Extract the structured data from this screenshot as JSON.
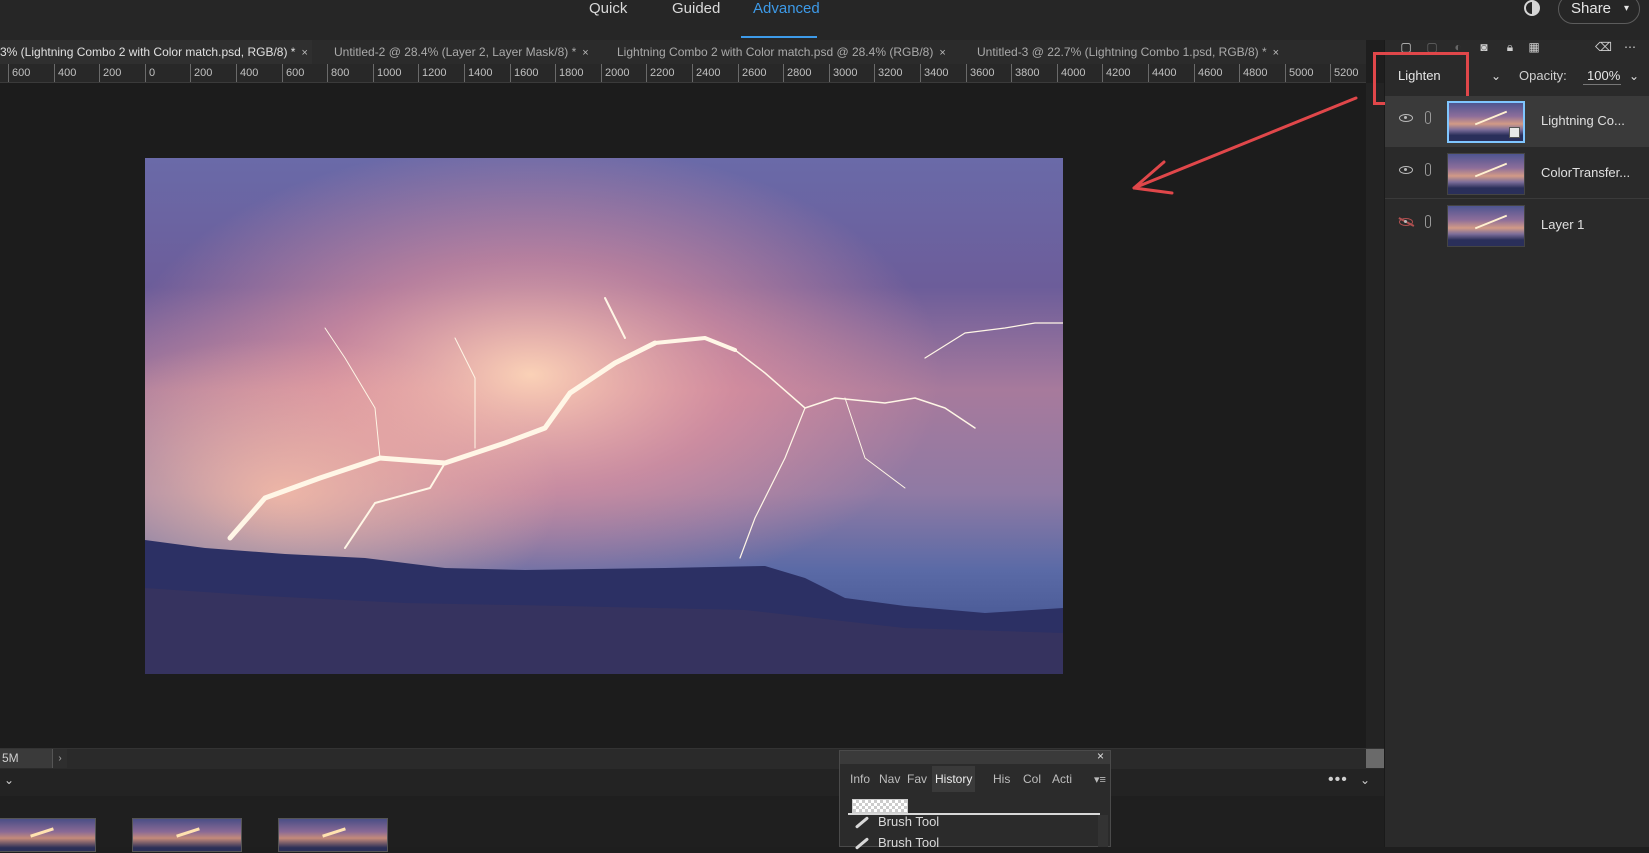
{
  "modes": {
    "quick": "Quick",
    "guided": "Guided",
    "advanced": "Advanced",
    "active": "Advanced"
  },
  "share": {
    "label": "Share",
    "caret": "▾"
  },
  "document_tabs": [
    {
      "title": "3% (Lightning Combo 2 with Color match.psd, RGB/8) *",
      "close": "×",
      "active": true
    },
    {
      "title": "Untitled-2 @ 28.4% (Layer 2, Layer Mask/8) *",
      "close": "×",
      "active": false
    },
    {
      "title": "Lightning Combo 2 with Color match.psd @ 28.4% (RGB/8)",
      "close": "×",
      "active": false
    },
    {
      "title": "Untitled-3 @ 22.7% (Lightning Combo 1.psd, RGB/8) *",
      "close": "×",
      "active": false
    }
  ],
  "ruler": {
    "ticks": [
      "600",
      "400",
      "200",
      "0",
      "200",
      "400",
      "600",
      "800",
      "1000",
      "1200",
      "1400",
      "1600",
      "1800",
      "2000",
      "2200",
      "2400",
      "2600",
      "2800",
      "3000",
      "3200",
      "3400",
      "3600",
      "3800",
      "4000",
      "4200",
      "4400",
      "4600",
      "4800",
      "5000",
      "5200"
    ]
  },
  "status": {
    "doc_size": "5M",
    "arrow": "›"
  },
  "photo_bin": {
    "collapse": "⌄",
    "more": "•••",
    "chevron": "⌄"
  },
  "layers_panel": {
    "toolbar_icons": [
      "new-layer-icon",
      "new-group-icon",
      "adjustment-layer-icon",
      "layer-mask-icon",
      "lock-icon",
      "lock-transparency-icon",
      "trash-icon",
      "more-icon"
    ],
    "toolbar_glyphs": {
      "more": "⋯",
      "trash": "🗑"
    },
    "blend_mode": "Lighten",
    "opacity_label": "Opacity:",
    "opacity_value": "100%",
    "chevron": "⌄",
    "layers": [
      {
        "name": "Lightning Co...",
        "visible": true,
        "selected": true,
        "smart_object": true
      },
      {
        "name": "ColorTransfer...",
        "visible": true,
        "selected": false,
        "smart_object": false
      },
      {
        "name": "Layer 1",
        "visible": false,
        "selected": false,
        "smart_object": false
      }
    ]
  },
  "history_panel": {
    "close": "×",
    "tabs": [
      "Info",
      "Nav",
      "Fav",
      "History",
      "His",
      "Col",
      "Acti"
    ],
    "active_tab": "History",
    "menu": "▾≡",
    "items": [
      "Brush Tool",
      "Brush Tool"
    ]
  },
  "colors": {
    "accent": "#3d9ae8",
    "annotation": "#e0474a"
  }
}
